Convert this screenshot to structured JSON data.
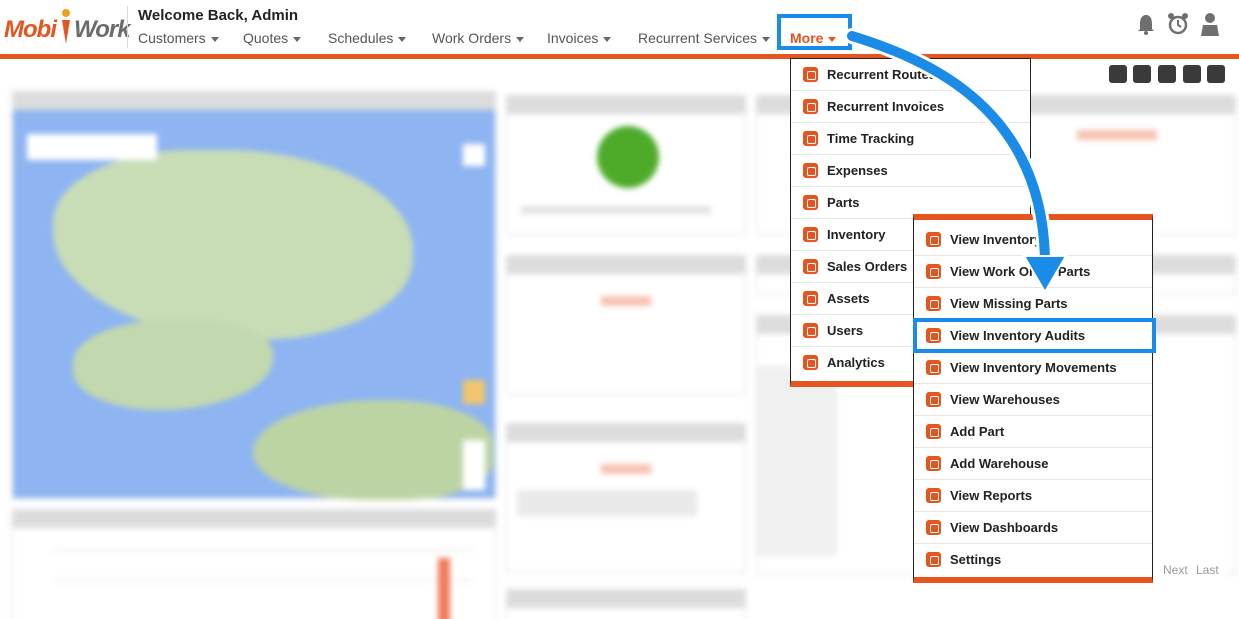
{
  "header": {
    "welcome": "Welcome Back,  Admin",
    "logo_left": "Mobi",
    "logo_right": "Work",
    "nav": [
      "Customers",
      "Quotes",
      "Schedules",
      "Work Orders",
      "Invoices",
      "Recurrent Services"
    ],
    "more_label": "More"
  },
  "colors": {
    "accent": "#e5551f",
    "highlight": "#1a8be6"
  },
  "icons": [
    "bell-icon",
    "alarm-clock-icon",
    "user-icon"
  ],
  "more_menu": {
    "items": [
      {
        "label": "Recurrent Routes",
        "icon": "routes-icon"
      },
      {
        "label": "Recurrent Invoices",
        "icon": "dollar-icon"
      },
      {
        "label": "Time Tracking",
        "icon": "clock-icon"
      },
      {
        "label": "Expenses",
        "icon": "expenses-icon"
      },
      {
        "label": "Parts",
        "icon": "parts-icon"
      },
      {
        "label": "Inventory",
        "icon": "inventory-icon"
      },
      {
        "label": "Sales Orders",
        "icon": "sales-orders-icon"
      },
      {
        "label": "Assets",
        "icon": "assets-icon"
      },
      {
        "label": "Users",
        "icon": "users-icon"
      },
      {
        "label": "Analytics",
        "icon": "analytics-icon"
      }
    ]
  },
  "inventory_submenu": {
    "items": [
      {
        "label": "View Inventory"
      },
      {
        "label": "View Work Order Parts"
      },
      {
        "label": "View Missing Parts"
      },
      {
        "label": "View Inventory Audits"
      },
      {
        "label": "View Inventory Movements"
      },
      {
        "label": "View Warehouses"
      },
      {
        "label": "Add Part"
      },
      {
        "label": "Add Warehouse"
      },
      {
        "label": "View Reports"
      },
      {
        "label": "View Dashboards"
      },
      {
        "label": "Settings"
      }
    ],
    "highlighted": "View Inventory Audits"
  },
  "pager": {
    "next": "Next",
    "last": "Last"
  }
}
